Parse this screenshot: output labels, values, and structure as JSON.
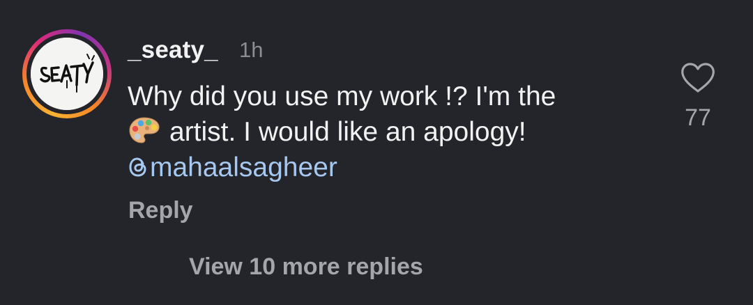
{
  "comment": {
    "username": "_seaty_",
    "timestamp": "1h",
    "text_line_1": "Why did you use my work !? I'm the",
    "text_line_2": "artist. I would like an apology!",
    "emoji_icon": "artist-palette-icon",
    "mention": "mahaalsagheer",
    "mention_icon": "threads-icon",
    "reply_label": "Reply",
    "like_icon": "heart-outline-icon",
    "like_count": "77",
    "avatar_logo_text": "SEATY"
  },
  "replies": {
    "view_more_label": "View 10 more replies"
  },
  "colors": {
    "background": "#24252a",
    "primary_text": "#f2f2f3",
    "secondary_text": "#a4a6ab",
    "timestamp": "#8b8d93",
    "mention": "#a6c8ef"
  }
}
